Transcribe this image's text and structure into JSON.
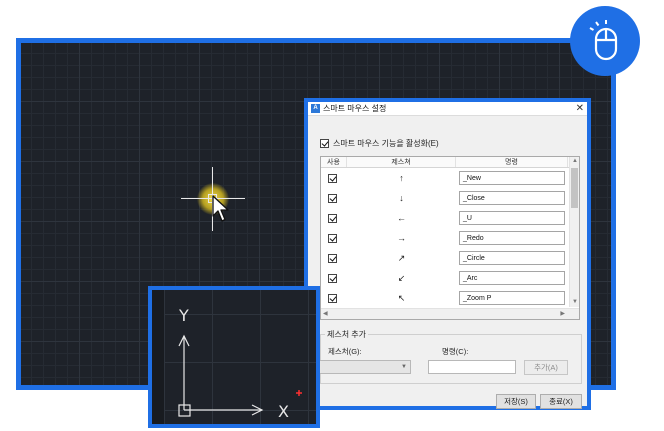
{
  "dialog": {
    "title": "스마트 마우스 설정",
    "app_icon_text": "A",
    "close_symbol": "✕",
    "enable_label": "스마트 마우스 기능을 활성화(E)",
    "enable_checked": true,
    "table": {
      "headers": {
        "use": "사용",
        "gesture": "제스쳐",
        "command": "명령"
      },
      "rows": [
        {
          "checked": true,
          "gesture": "↑",
          "command": "_New"
        },
        {
          "checked": true,
          "gesture": "↓",
          "command": "_Close"
        },
        {
          "checked": true,
          "gesture": "←",
          "command": "_U"
        },
        {
          "checked": true,
          "gesture": "→",
          "command": "_Redo"
        },
        {
          "checked": true,
          "gesture": "↗",
          "command": "_Circle"
        },
        {
          "checked": true,
          "gesture": "↙",
          "command": "_Arc"
        },
        {
          "checked": true,
          "gesture": "↖",
          "command": "_Zoom P"
        }
      ]
    },
    "add_group": {
      "legend": "제스처 추가",
      "gesture_label": "제스처(G):",
      "command_label": "명령(C):",
      "add_button": "추가(A)"
    },
    "save_button": "저장(S)",
    "close_button": "종료(X)"
  },
  "ucs": {
    "y_label": "Y",
    "x_label": "X"
  },
  "colors": {
    "accent": "#1f6fe5",
    "canvas": "#1e2229",
    "highlight": "#e6c81e",
    "ucs_marker": "#ff3030"
  },
  "icons": {
    "badge": "mouse-icon",
    "cursor": "arrow-cursor-icon"
  }
}
